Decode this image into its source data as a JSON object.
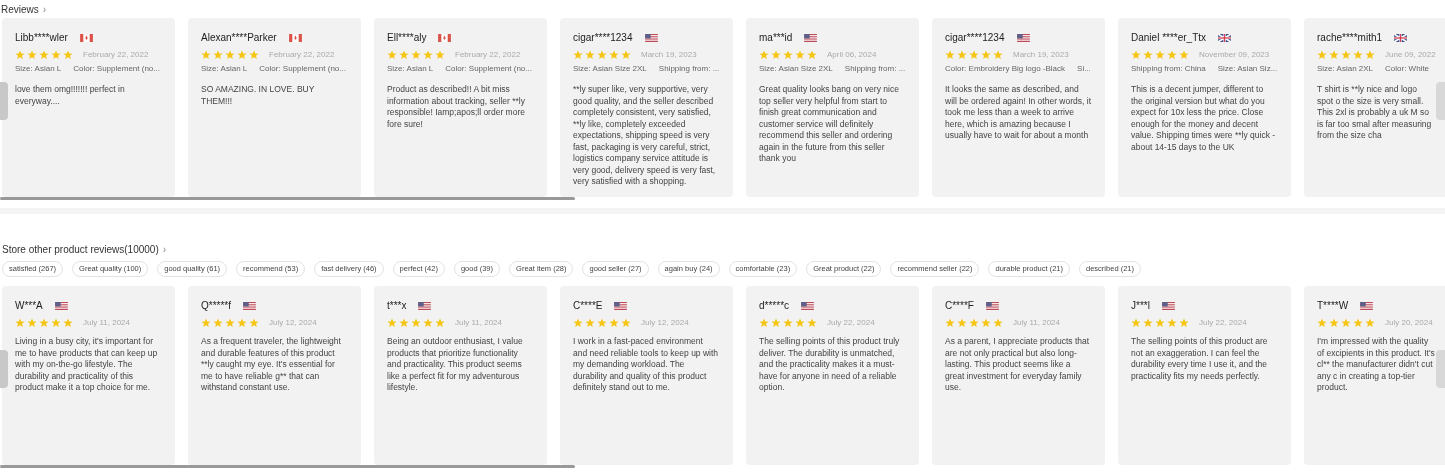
{
  "reviews_section": {
    "title": "Reviews",
    "chevron": "›",
    "reviews": [
      {
        "name": "Libb****wler",
        "kind": "ca",
        "stars": 5,
        "date": "February 22, 2022",
        "specs": [
          "Size: Asian L",
          "Color: Supplement (no..."
        ],
        "text": "love them omg!!!!!!! perfect in everyway...."
      },
      {
        "name": "Alexan****Parker",
        "kind": "ca",
        "stars": 5,
        "date": "February 22, 2022",
        "specs": [
          "Size: Asian L",
          "Color: Supplement (no..."
        ],
        "text": "SO AMAZING. IN LOVE. BUY THEM!!!"
      },
      {
        "name": "Ell****aly",
        "kind": "ca",
        "stars": 5,
        "date": "February 22, 2022",
        "specs": [
          "Size: Asian L",
          "Color: Supplement (no..."
        ],
        "text": "Product as described!! A bit miss information about tracking, seller **ly responsible! Iamp;apos;ll order more fore sure!"
      },
      {
        "name": "cigar****1234",
        "kind": "us",
        "stars": 5,
        "date": "March 19, 2023",
        "specs": [
          "Size: Asian Size 2XL",
          "Shipping from: ..."
        ],
        "text": "**ly super like, very supportive, very good quality, and the seller described completely consistent, very satisfied, **ly like, completely exceeded expectations, shipping speed is very fast, packaging is very careful, strict, logistics company service attitude is very good, delivery speed is very fast, very satisfied with a shopping."
      },
      {
        "name": "ma***id",
        "kind": "us",
        "stars": 5,
        "date": "April 06, 2024",
        "specs": [
          "Size: Asian Size 2XL",
          "Shipping from: ..."
        ],
        "text": "Great quality looks bang on very nice top seller very helpful from start to finish great communication and customer service will definitely recommend this seller and ordering again in the future from this seller thank you"
      },
      {
        "name": "cigar****1234",
        "kind": "us",
        "stars": 5,
        "date": "March 19, 2023",
        "specs": [
          "Color: Embroidery Big logo -Black",
          "Si..."
        ],
        "text": "It looks the same as described, and will be ordered again! In other words, it took me less than a week to arrive here, which is amazing because I usually have to wait for about a month"
      },
      {
        "name": "Daniel ****er_Ttx",
        "kind": "gb",
        "stars": 5,
        "date": "November 09, 2023",
        "specs": [
          "Shipping from: China",
          "Size: Asian Siz..."
        ],
        "text": "This is a decent jumper, different to the original version but what do you expect for 10x less the price. Close enough for the money and decent value. Shipping times were **ly quick - about 14-15 days to the UK"
      },
      {
        "name": "rache****mith1",
        "kind": "gb",
        "stars": 5,
        "date": "June 09, 2022",
        "specs": [
          "Size: Asian 2XL",
          "Color: White"
        ],
        "text": "T shirt is **ly nice and logo spot o the size is very small. This 2xl is probably a uk M so is far too smal after measuring from the size cha"
      }
    ]
  },
  "store_section": {
    "title": "Store other product reviews(10000)",
    "chevron": "›",
    "tags": [
      "satisfied (267)",
      "Great quality (100)",
      "good quality (61)",
      "recommend (53)",
      "fast delivery (46)",
      "perfect (42)",
      "good (39)",
      "Great item (28)",
      "good seller (27)",
      "again buy (24)",
      "comfortable (23)",
      "Great product (22)",
      "recommend seller (22)",
      "durable product (21)",
      "described (21)"
    ],
    "reviews": [
      {
        "name": "W***A",
        "kind": "us",
        "stars": 5,
        "date": "July 11, 2024",
        "text": "Living in a busy city, it's important for me to have products that can keep up with my on-the-go lifestyle. The durability and practicality of this product make it a top choice for me."
      },
      {
        "name": "Q*****f",
        "kind": "us",
        "stars": 5,
        "date": "July 12, 2024",
        "text": "As a frequent traveler, the lightweight and durable features of this product **ly caught my eye. It's essential for me to have reliable g** that can withstand constant use."
      },
      {
        "name": "t***x",
        "kind": "us",
        "stars": 5,
        "date": "July 11, 2024",
        "text": "Being an outdoor enthusiast, I value products that prioritize functionality and practicality. This product seems like a perfect fit for my adventurous lifestyle."
      },
      {
        "name": "C****E",
        "kind": "us",
        "stars": 5,
        "date": "July 12, 2024",
        "text": "I work in a fast-paced environment and need reliable tools to keep up with my demanding workload. The durability and quality of this product definitely stand out to me."
      },
      {
        "name": "d*****c",
        "kind": "us",
        "stars": 5,
        "date": "July 22, 2024",
        "text": "The selling points of this product truly deliver. The durability is unmatched, and the practicality makes it a must-have for anyone in need of a reliable option."
      },
      {
        "name": "C****F",
        "kind": "us",
        "stars": 5,
        "date": "July 11, 2024",
        "text": "As a parent, I appreciate products that are not only practical but also long-lasting. This product seems like a great investment for everyday family use."
      },
      {
        "name": "J***l",
        "kind": "us",
        "stars": 5,
        "date": "July 22, 2024",
        "text": "The selling points of this product are not an exaggeration. I can feel the durability every time I use it, and the practicality fits my needs perfectly."
      },
      {
        "name": "T****W",
        "kind": "us",
        "stars": 5,
        "date": "July 20, 2024",
        "text": "I'm impressed with the quality of excipients in this product. It's cl** the manufacturer didn't cut any c in creating a top-tier product."
      }
    ]
  }
}
